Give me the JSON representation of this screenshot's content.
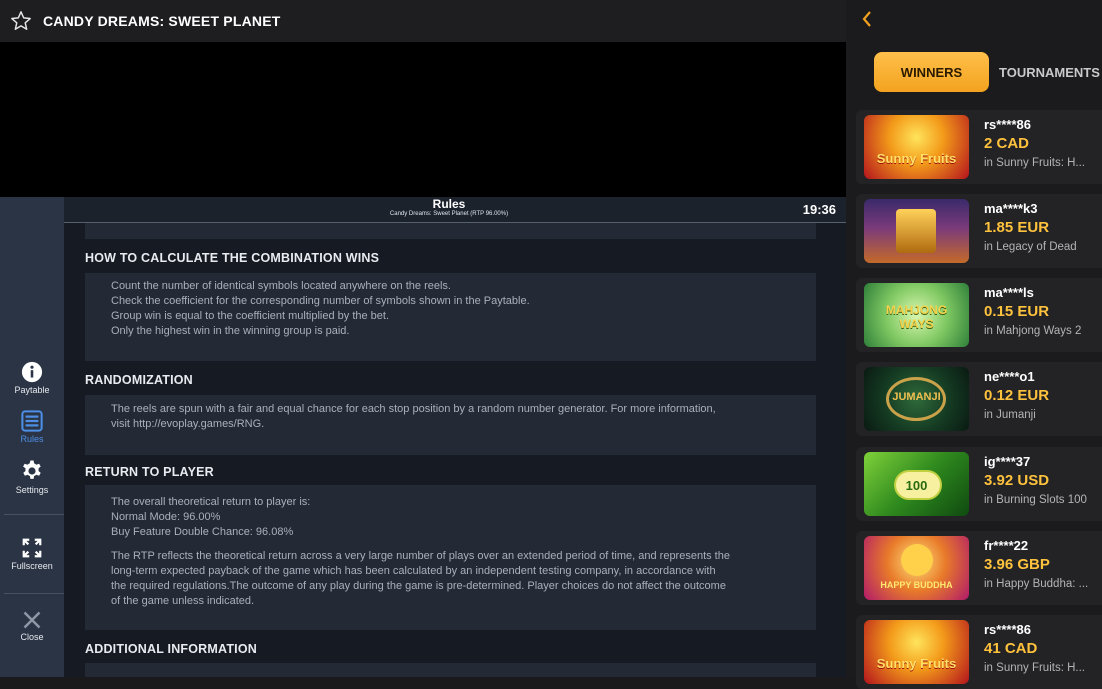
{
  "header": {
    "title": "CANDY DREAMS: SWEET PLANET",
    "favorite_icon": "star-icon"
  },
  "game_menu": {
    "items": [
      {
        "label": "Paytable",
        "icon": "info-icon"
      },
      {
        "label": "Rules",
        "icon": "list-icon"
      },
      {
        "label": "Settings",
        "icon": "gear-icon"
      },
      {
        "label": "Fullscreen",
        "icon": "fullscreen-icon"
      },
      {
        "label": "Close",
        "icon": "close-icon"
      }
    ],
    "active_color": "#4c8fe8"
  },
  "rules": {
    "title": "Rules",
    "subtitle": "Candy Dreams: Sweet Planet (RTP 96.00%)",
    "clock": "19:36",
    "sections": [
      {
        "heading": "HOW TO CALCULATE THE COMBINATION WINS",
        "lines": [
          "Count the number of identical symbols located anywhere on the reels.",
          "Check the coefficient for the corresponding number of symbols shown in the Paytable.",
          "Group win is equal to the coefficient multiplied by the bet.",
          "Only the highest win in the winning group is paid."
        ]
      },
      {
        "heading": "RANDOMIZATION",
        "lines": [
          "The reels are spun with a fair and equal chance for each stop position by a random number generator. For more information,",
          "visit http://evoplay.games/RNG."
        ]
      },
      {
        "heading": "RETURN TO PLAYER",
        "lines": [
          "The overall theoretical return to player is:",
          "Normal Mode: 96.00%",
          "Buy Feature Double Chance: 96.08%"
        ],
        "lines2": [
          "The RTP reflects the theoretical return across a very large number of plays over an extended period of time, and represents the",
          "long-term expected payback of the game which has been calculated by an independent testing company, in accordance with",
          "the required regulations.The outcome of any play during the game is pre-determined. Player choices do not affect the outcome",
          "of the game unless indicated."
        ]
      },
      {
        "heading": "ADDITIONAL INFORMATION",
        "lines": []
      }
    ]
  },
  "sidebar": {
    "back_icon": "chevron-left-icon",
    "tabs": [
      {
        "label": "WINNERS",
        "active": true
      },
      {
        "label": "TOURNAMENTS",
        "active": false
      }
    ],
    "accent": "#ffc23d",
    "winners": [
      {
        "user": "rs****86",
        "amount": "2 CAD",
        "game": "in Sunny Fruits: H..."
      },
      {
        "user": "ma****k3",
        "amount": "1.85 EUR",
        "game": "in Legacy of Dead"
      },
      {
        "user": "ma****ls",
        "amount": "0.15 EUR",
        "game": "in Mahjong Ways 2"
      },
      {
        "user": "ne****o1",
        "amount": "0.12 EUR",
        "game": "in Jumanji"
      },
      {
        "user": "ig****37",
        "amount": "3.92 USD",
        "game": "in Burning Slots 100"
      },
      {
        "user": "fr****22",
        "amount": "3.96 GBP",
        "game": "in Happy Buddha: ..."
      },
      {
        "user": "rs****86",
        "amount": "41 CAD",
        "game": "in Sunny Fruits: H..."
      }
    ]
  }
}
